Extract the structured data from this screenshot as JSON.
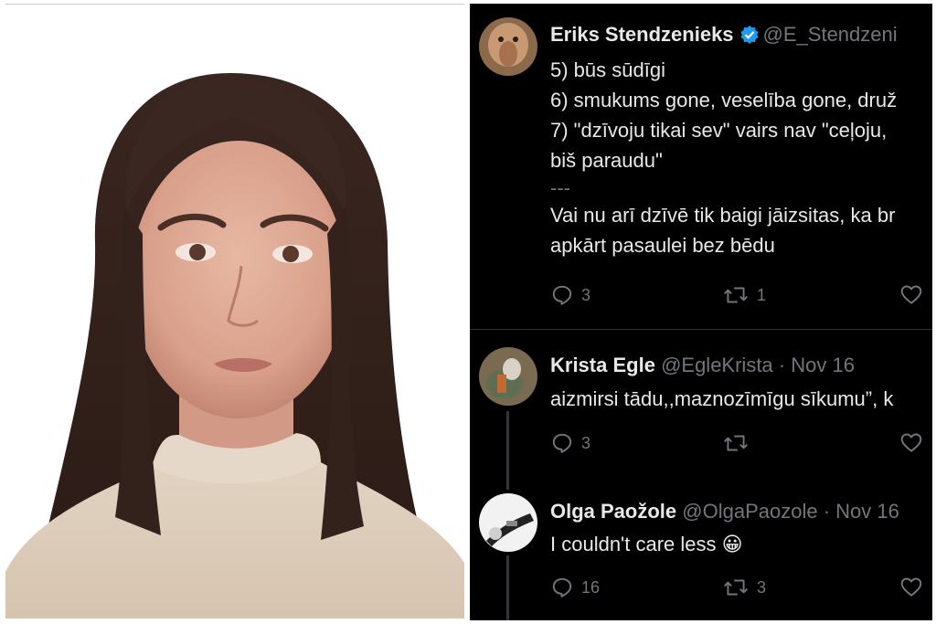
{
  "tweets": [
    {
      "name": "Eriks Stendzenieks",
      "handle": "@E_Stendzeni",
      "verified": true,
      "lines": [
        "5) būs sūdīgi",
        "6) smukums gone, veselība gone, druž",
        "7) \"dzīvoju tikai sev\" vairs nav \"ceļoju,",
        "biš paraudu\"",
        "---",
        "Vai nu arī dzīvē tik baigi jāizsitas, ka br",
        "apkārt pasaulei bez bēdu"
      ],
      "replies": "3",
      "retweets": "1",
      "likes": ""
    },
    {
      "name": "Krista Egle",
      "handle": "@EgleKrista",
      "date": "· Nov 16",
      "lines": [
        "aizmirsi tādu,,maznozīmīgu sīkumu”, k"
      ],
      "replies": "3",
      "retweets": "",
      "likes": ""
    },
    {
      "name": "Olga Paožole",
      "handle": "@OlgaPaozole",
      "date": "· Nov 16",
      "lines": [
        "I couldn't care less 😀"
      ],
      "replies": "16",
      "retweets": "3",
      "likes": ""
    }
  ],
  "colors": {
    "background": "#000000",
    "text": "#e7e9ea",
    "muted": "#71767b",
    "verified": "#1d9bf0",
    "divider": "#2f3336"
  },
  "icons": [
    "reply-icon",
    "retweet-icon",
    "like-icon",
    "verified-badge-icon"
  ]
}
